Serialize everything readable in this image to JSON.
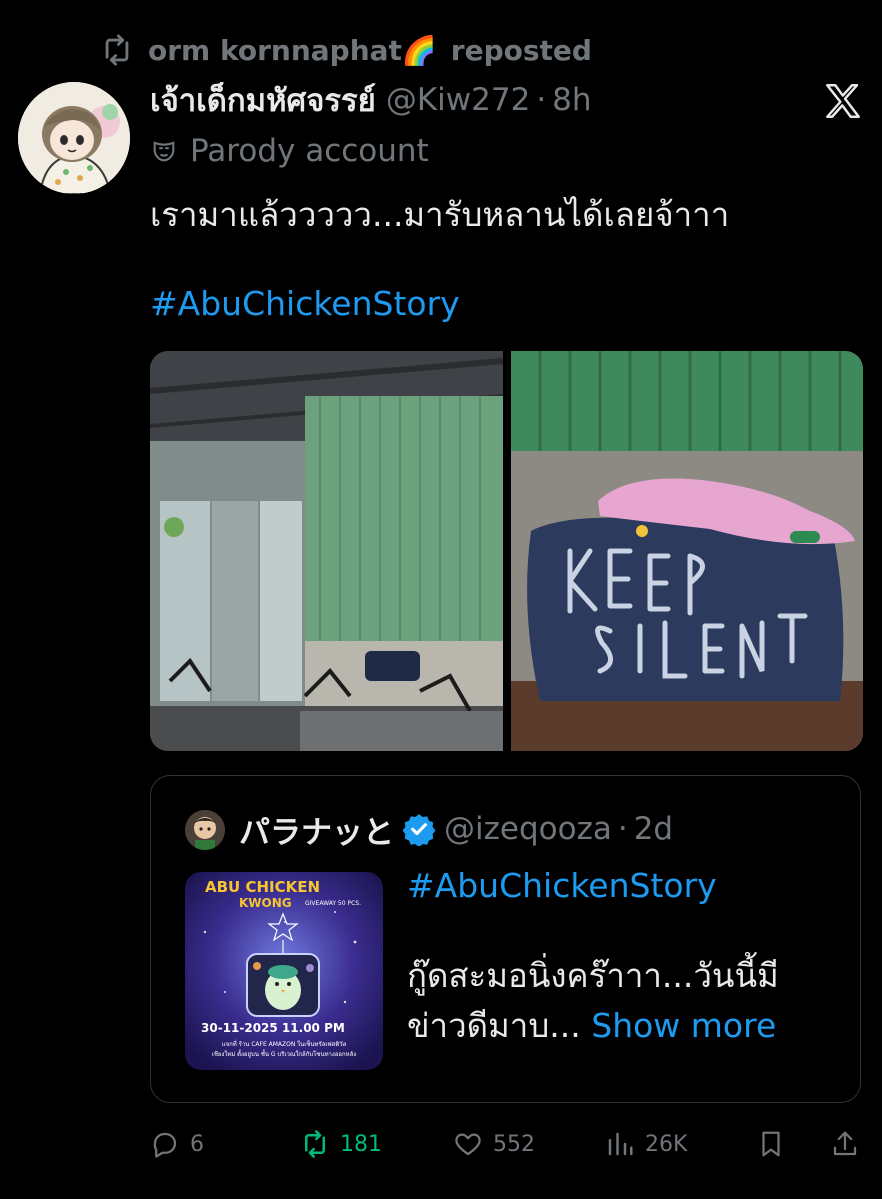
{
  "repost": {
    "user": "orm kornnaphat",
    "emoji": "🌈",
    "label": "reposted"
  },
  "tweet": {
    "display_name": "เจ้าเด็กมหัศจรรย์",
    "handle": "@Kiw272",
    "separator": "·",
    "time": "8h",
    "account_label": "Parody account",
    "text": "เรามาแล้ววววว...มารับหลานได้เลยจ้าาา",
    "hashtag": "#AbuChickenStory"
  },
  "quote": {
    "display_name": "パラナッと",
    "handle": "@izeqooza",
    "separator": "·",
    "time": "2d",
    "hashtag": "#AbuChickenStory",
    "text": "กู๊ดสะมอนิ่งคร๊าาา...วันนี้มีข่าวดีมาบ...",
    "show_more": "Show more",
    "thumbnail": {
      "title": "ABU CHICKEN",
      "subtitle": "KWONG",
      "giveaway": "GIVEAWAY 50 PCS.",
      "date": "30-11-2025  11.00 PM",
      "line1": "แจกที่ ร้าน CAFE AMAZON ในเซ็นทรัลเฟสติวัล",
      "line2": "เชียงใหม่ ตั้งอยู่บน ชั้น G บริเวณใกล้กับโซนทางออกหลัง"
    }
  },
  "actions": {
    "replies": "6",
    "reposts": "181",
    "likes": "552",
    "views": "26K"
  },
  "colors": {
    "accent": "#1d9bf0",
    "repost": "#00ba7c",
    "muted": "#71767b",
    "background": "#000000"
  },
  "icons": [
    "repost-icon",
    "x-logo-icon",
    "parody-mask-icon",
    "verified-badge-icon",
    "reply-icon",
    "like-icon",
    "views-icon",
    "bookmark-icon",
    "share-icon"
  ]
}
